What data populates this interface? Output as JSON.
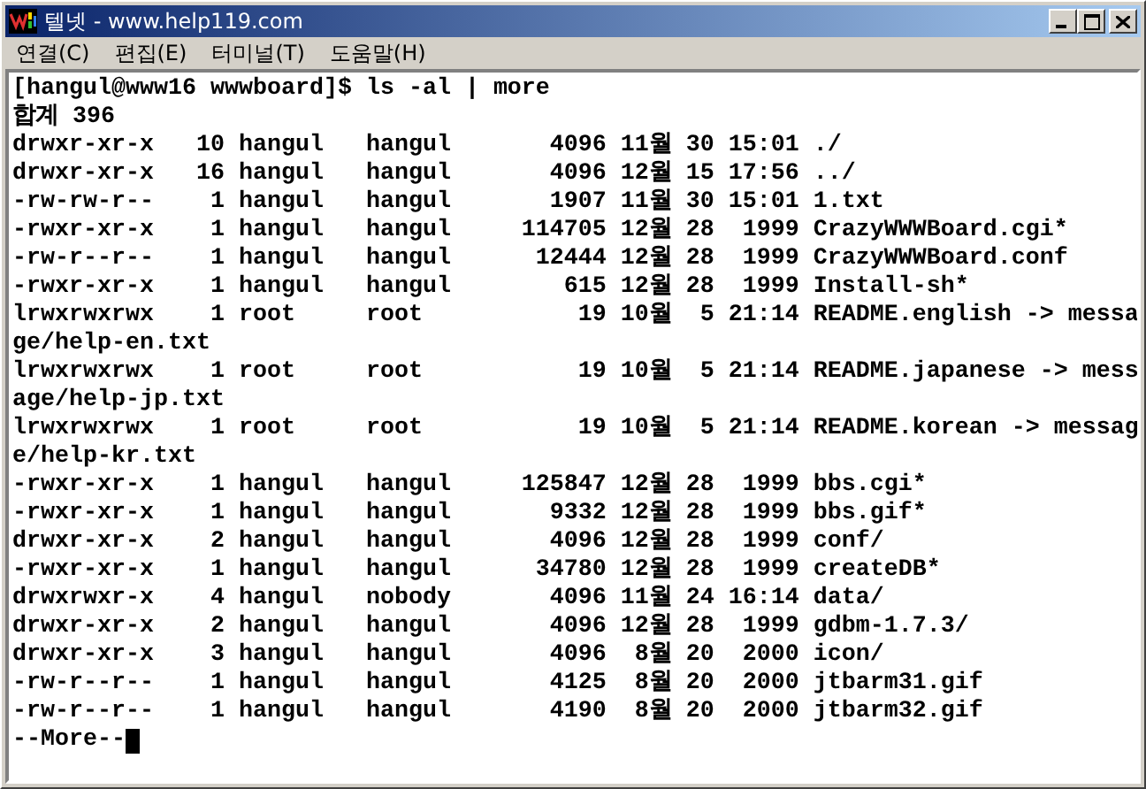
{
  "window": {
    "title": "텔넷 - www.help119.com"
  },
  "menu": [
    "연결(C)",
    "편집(E)",
    "터미널(T)",
    "도움말(H)"
  ],
  "terminal": {
    "lines": [
      "[hangul@www16 wwwboard]$ ls -al | more",
      "합계 396",
      "drwxr-xr-x   10 hangul   hangul       4096 11월 30 15:01 ./",
      "drwxr-xr-x   16 hangul   hangul       4096 12월 15 17:56 ../",
      "-rw-rw-r--    1 hangul   hangul       1907 11월 30 15:01 1.txt",
      "-rwxr-xr-x    1 hangul   hangul     114705 12월 28  1999 CrazyWWWBoard.cgi*",
      "-rw-r--r--    1 hangul   hangul      12444 12월 28  1999 CrazyWWWBoard.conf",
      "-rwxr-xr-x    1 hangul   hangul        615 12월 28  1999 Install-sh*",
      "lrwxrwxrwx    1 root     root           19 10월  5 21:14 README.english -> messa",
      "ge/help-en.txt",
      "lrwxrwxrwx    1 root     root           19 10월  5 21:14 README.japanese -> mess",
      "age/help-jp.txt",
      "lrwxrwxrwx    1 root     root           19 10월  5 21:14 README.korean -> messag",
      "e/help-kr.txt",
      "-rwxr-xr-x    1 hangul   hangul     125847 12월 28  1999 bbs.cgi*",
      "-rwxr-xr-x    1 hangul   hangul       9332 12월 28  1999 bbs.gif*",
      "drwxr-xr-x    2 hangul   hangul       4096 12월 28  1999 conf/",
      "-rwxr-xr-x    1 hangul   hangul      34780 12월 28  1999 createDB*",
      "drwxrwxr-x    4 hangul   nobody       4096 11월 24 16:14 data/",
      "drwxr-xr-x    2 hangul   hangul       4096 12월 28  1999 gdbm-1.7.3/",
      "drwxr-xr-x    3 hangul   hangul       4096  8월 20  2000 icon/",
      "-rw-r--r--    1 hangul   hangul       4125  8월 20  2000 jtbarm31.gif",
      "-rw-r--r--    1 hangul   hangul       4190  8월 20  2000 jtbarm32.gif"
    ],
    "prompt": "--More--"
  }
}
